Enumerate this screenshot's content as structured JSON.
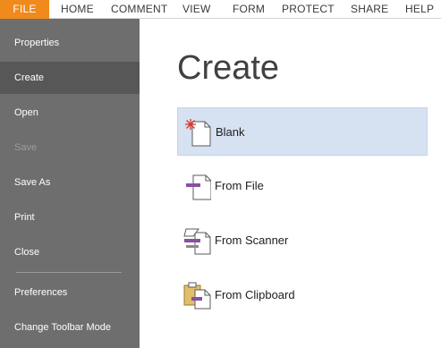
{
  "tabs": [
    "FILE",
    "HOME",
    "COMMENT",
    "VIEW",
    "FORM",
    "PROTECT",
    "SHARE",
    "HELP"
  ],
  "sidebar": {
    "items": [
      {
        "label": "Properties"
      },
      {
        "label": "Create",
        "active": true
      },
      {
        "label": "Open"
      },
      {
        "label": "Save",
        "disabled": true
      },
      {
        "label": "Save As"
      },
      {
        "label": "Print"
      },
      {
        "label": "Close"
      },
      {
        "label": "Preferences"
      },
      {
        "label": "Change Toolbar Mode"
      }
    ]
  },
  "main": {
    "title": "Create",
    "options": [
      {
        "label": "Blank",
        "icon": "blank-page-icon",
        "selected": true
      },
      {
        "label": "From File",
        "icon": "from-file-icon"
      },
      {
        "label": "From Scanner",
        "icon": "from-scanner-icon"
      },
      {
        "label": "From Clipboard",
        "icon": "from-clipboard-icon"
      }
    ]
  },
  "colors": {
    "file_tab": "#f08a1c",
    "sidebar_bg": "#6e6e6e",
    "sidebar_active": "#575757",
    "selected_bg": "#d6e1f2",
    "icon_accent": "#8a4fa0"
  }
}
